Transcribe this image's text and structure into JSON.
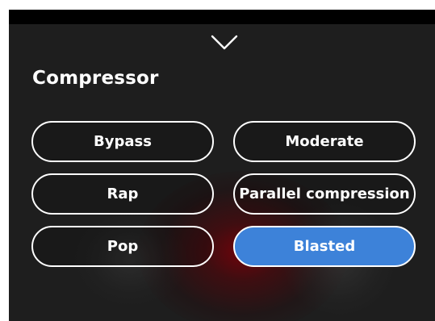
{
  "panel": {
    "title": "Compressor",
    "collapse_icon": "chevron-down-icon"
  },
  "presets": [
    {
      "label": "Bypass",
      "selected": false
    },
    {
      "label": "Moderate",
      "selected": false
    },
    {
      "label": "Rap",
      "selected": false
    },
    {
      "label": "Parallel compression",
      "selected": false
    },
    {
      "label": "Pop",
      "selected": false
    },
    {
      "label": "Blasted",
      "selected": true
    }
  ],
  "colors": {
    "background": "#1e1e1e",
    "selected_fill": "#3d82d9",
    "outline": "#ffffff"
  }
}
